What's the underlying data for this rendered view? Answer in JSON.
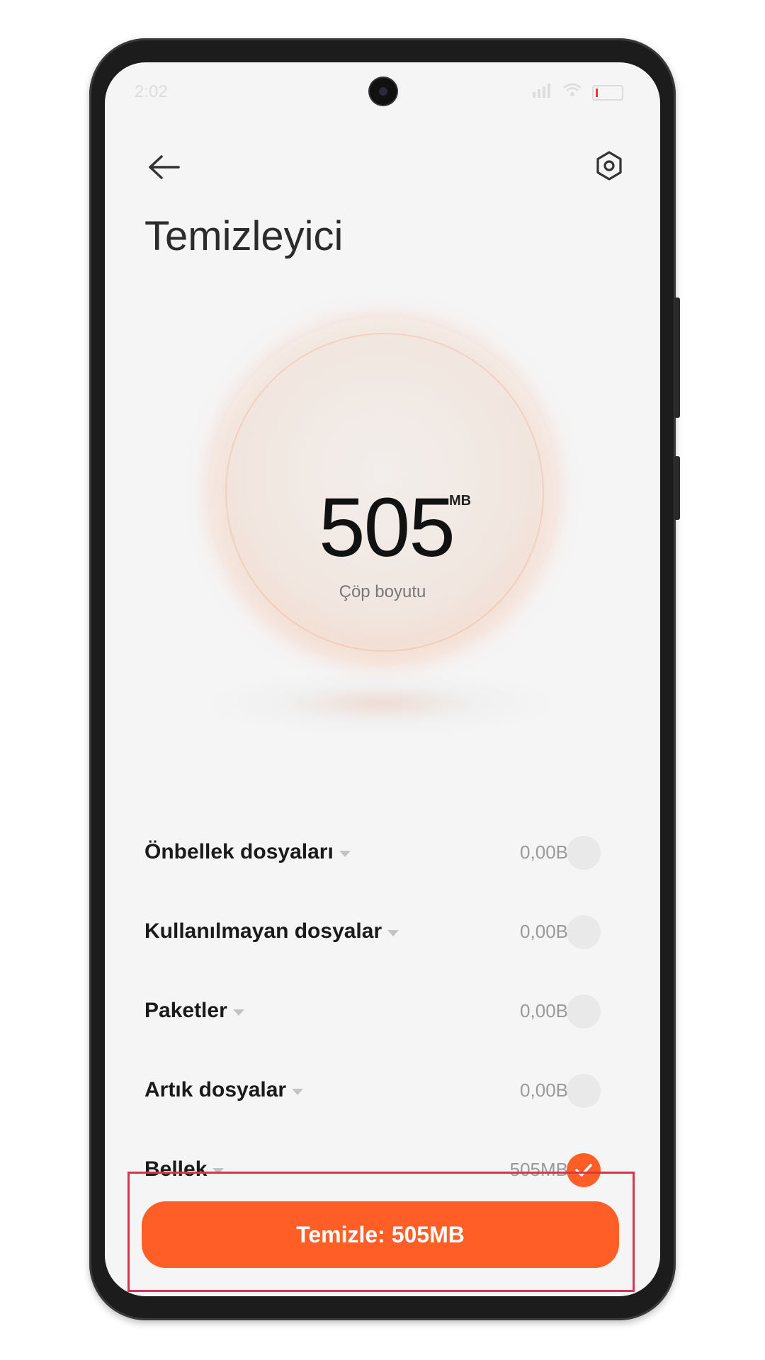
{
  "status_bar": {
    "time": "2:02"
  },
  "header": {
    "title": "Temizleyici"
  },
  "junk": {
    "value": "505",
    "unit": "MB",
    "label": "Çöp boyutu"
  },
  "items": [
    {
      "label": "Önbellek dosyaları",
      "size": "0,00B",
      "checked": false
    },
    {
      "label": "Kullanılmayan dosyalar",
      "size": "0,00B",
      "checked": false
    },
    {
      "label": "Paketler",
      "size": "0,00B",
      "checked": false
    },
    {
      "label": "Artık dosyalar",
      "size": "0,00B",
      "checked": false
    },
    {
      "label": "Bellek",
      "size": "505MB",
      "checked": true
    }
  ],
  "action": {
    "clean_label": "Temizle: 505MB"
  },
  "colors": {
    "accent": "#ff5f27",
    "highlight": "#d8344e"
  },
  "icons": {
    "back": "arrow-left-icon",
    "settings": "hexagon-gear-icon",
    "check": "checkmark-icon",
    "expand": "caret-down-icon"
  }
}
